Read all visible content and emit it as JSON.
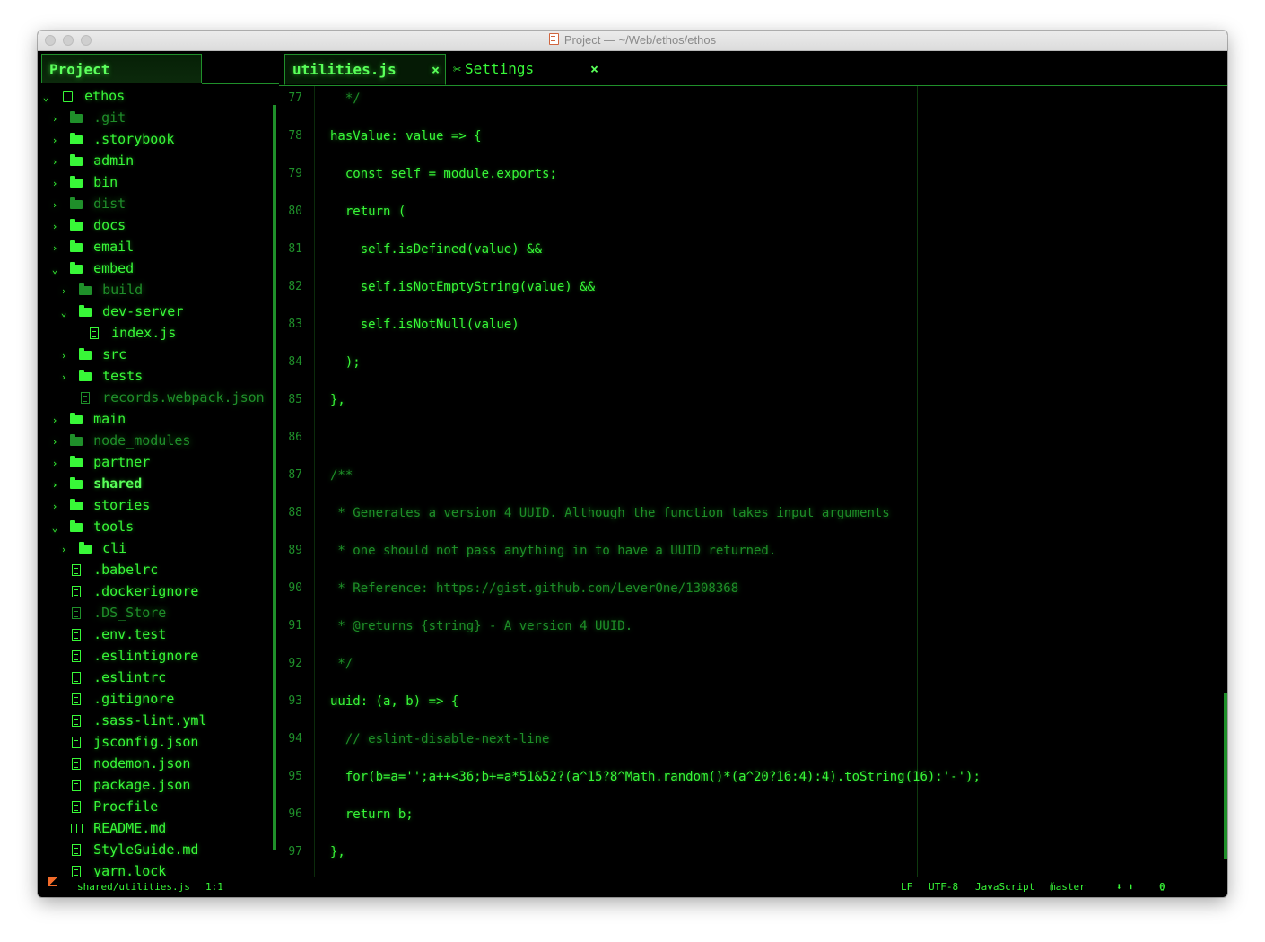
{
  "window": {
    "title": "Project — ~/Web/ethos/ethos"
  },
  "sidebar": {
    "tab_label": "Project",
    "root": "ethos",
    "items": [
      {
        "label": ".git",
        "type": "folder",
        "expanded": false,
        "dim": true
      },
      {
        "label": ".storybook",
        "type": "folder",
        "expanded": false
      },
      {
        "label": "admin",
        "type": "folder",
        "expanded": false
      },
      {
        "label": "bin",
        "type": "folder",
        "expanded": false
      },
      {
        "label": "dist",
        "type": "folder",
        "expanded": false,
        "dim": true
      },
      {
        "label": "docs",
        "type": "folder",
        "expanded": false
      },
      {
        "label": "email",
        "type": "folder",
        "expanded": false
      },
      {
        "label": "embed",
        "type": "folder",
        "expanded": true
      },
      {
        "label": "build",
        "type": "folder",
        "expanded": false,
        "dim": true
      },
      {
        "label": "dev-server",
        "type": "folder",
        "expanded": true
      },
      {
        "label": "index.js",
        "type": "file"
      },
      {
        "label": "src",
        "type": "folder",
        "expanded": false
      },
      {
        "label": "tests",
        "type": "folder",
        "expanded": false
      },
      {
        "label": "records.webpack.json",
        "type": "file",
        "dim": true
      },
      {
        "label": "main",
        "type": "folder",
        "expanded": false
      },
      {
        "label": "node_modules",
        "type": "folder",
        "expanded": false,
        "dim": true
      },
      {
        "label": "partner",
        "type": "folder",
        "expanded": false
      },
      {
        "label": "shared",
        "type": "folder",
        "expanded": false,
        "bold": true
      },
      {
        "label": "stories",
        "type": "folder",
        "expanded": false
      },
      {
        "label": "tools",
        "type": "folder",
        "expanded": true
      },
      {
        "label": "cli",
        "type": "folder",
        "expanded": false
      },
      {
        "label": ".babelrc",
        "type": "file"
      },
      {
        "label": ".dockerignore",
        "type": "file"
      },
      {
        "label": ".DS_Store",
        "type": "file",
        "dim": true
      },
      {
        "label": ".env.test",
        "type": "file"
      },
      {
        "label": ".eslintignore",
        "type": "file"
      },
      {
        "label": ".eslintrc",
        "type": "file"
      },
      {
        "label": ".gitignore",
        "type": "file"
      },
      {
        "label": ".sass-lint.yml",
        "type": "file"
      },
      {
        "label": "jsconfig.json",
        "type": "file"
      },
      {
        "label": "nodemon.json",
        "type": "file"
      },
      {
        "label": "package.json",
        "type": "file"
      },
      {
        "label": "Procfile",
        "type": "file"
      },
      {
        "label": "README.md",
        "type": "markdown"
      },
      {
        "label": "StyleGuide.md",
        "type": "file"
      },
      {
        "label": "yarn.lock",
        "type": "file"
      }
    ]
  },
  "tabs": [
    {
      "label": "utilities.js",
      "active": true,
      "close": "×"
    },
    {
      "label": "Settings",
      "active": false,
      "close": "×"
    }
  ],
  "editor": {
    "lines": [
      {
        "n": "77",
        "text": "  */"
      },
      {
        "n": "78",
        "text": "hasValue: value => {"
      },
      {
        "n": "79",
        "text": "  const self = module.exports;"
      },
      {
        "n": "80",
        "text": "  return ("
      },
      {
        "n": "81",
        "text": "    self.isDefined(value) &&"
      },
      {
        "n": "82",
        "text": "    self.isNotEmptyString(value) &&"
      },
      {
        "n": "83",
        "text": "    self.isNotNull(value)"
      },
      {
        "n": "84",
        "text": "  );"
      },
      {
        "n": "85",
        "text": "},"
      },
      {
        "n": "86",
        "text": ""
      },
      {
        "n": "87",
        "text": "/**"
      },
      {
        "n": "88",
        "text": " * Generates a version 4 UUID. Although the function takes input arguments"
      },
      {
        "n": "89",
        "text": " * one should not pass anything in to have a UUID returned."
      },
      {
        "n": "90",
        "text": " * Reference: https://gist.github.com/LeverOne/1308368"
      },
      {
        "n": "91",
        "text": " * @returns {string} - A version 4 UUID."
      },
      {
        "n": "92",
        "text": " */"
      },
      {
        "n": "93",
        "text": "uuid: (a, b) => {"
      },
      {
        "n": "94",
        "text": "  // eslint-disable-next-line"
      },
      {
        "n": "95",
        "text": "  for(b=a='';a++<36;b+=a*51&52?(a^15?8^Math.random()*(a^20?16:4):4).toString(16):'-');"
      },
      {
        "n": "96",
        "text": "  return b;"
      },
      {
        "n": "97",
        "text": "},"
      }
    ]
  },
  "statusbar": {
    "file_path": "shared/utilities.js",
    "cursor": "1:1",
    "line_ending": "LF",
    "encoding": "UTF-8",
    "grammar": "JavaScript",
    "branch": "master",
    "git_fetch": "⬇ ⬆",
    "files": "0 files"
  },
  "colors": {
    "accent": "#38f738",
    "dim": "#1f8f2a",
    "background": "#000000"
  }
}
